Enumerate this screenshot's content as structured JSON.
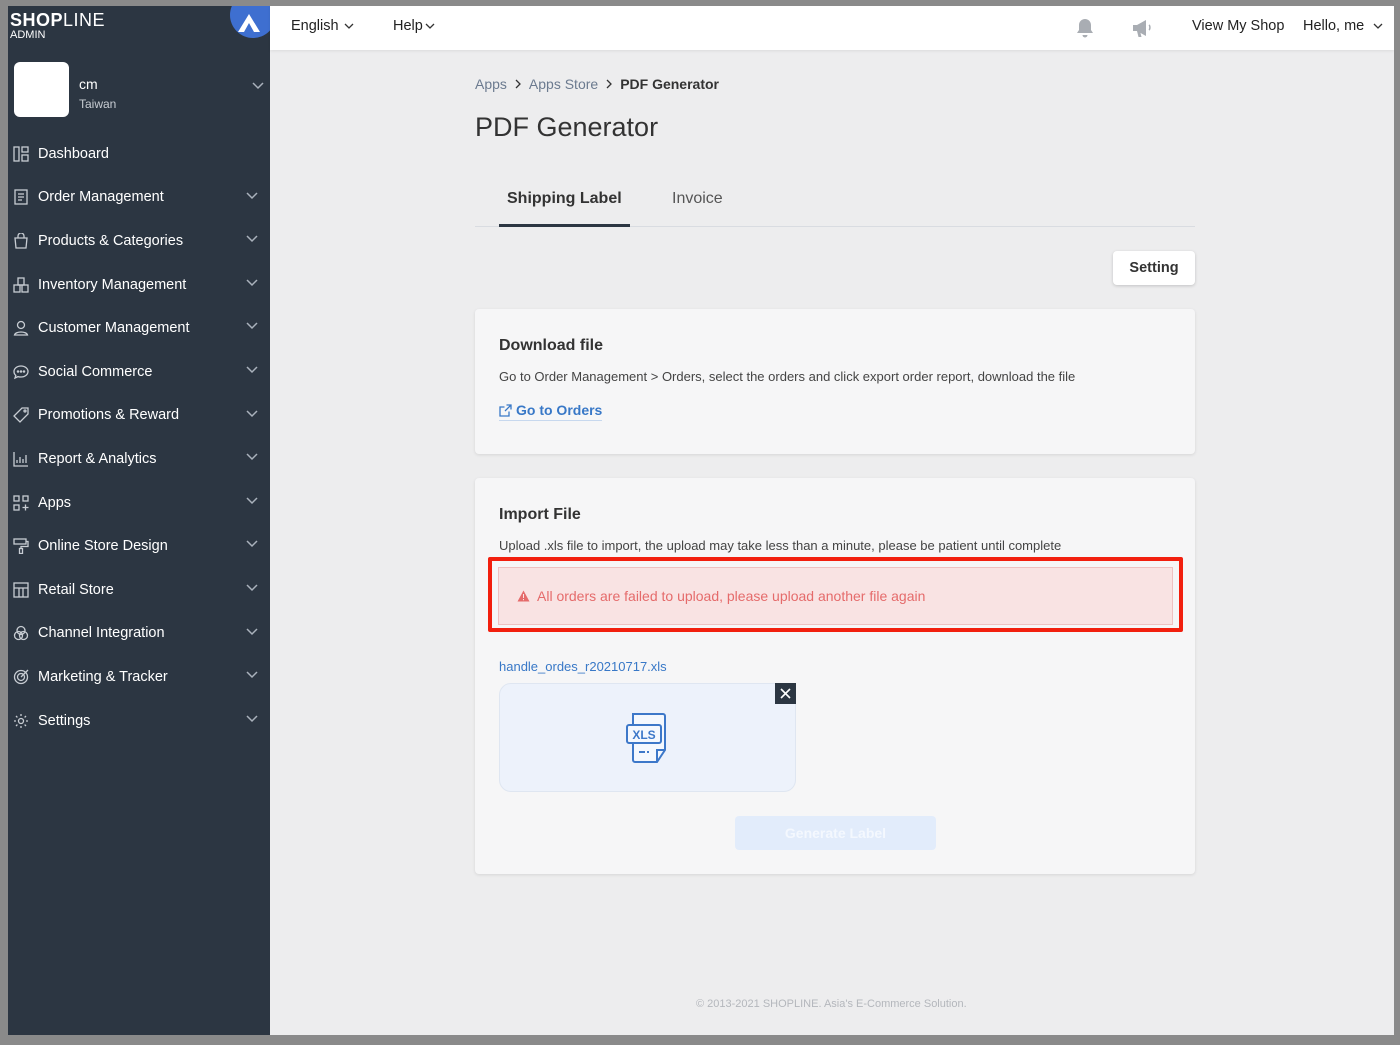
{
  "brand": {
    "name_bold": "SHOP",
    "name_thin": "LINE",
    "sub": "ADMIN"
  },
  "shop": {
    "name": "cm",
    "region": "Taiwan"
  },
  "sidebar": {
    "items": [
      {
        "label": "Dashboard",
        "icon": "dashboard-icon"
      },
      {
        "label": "Order Management",
        "icon": "order-icon"
      },
      {
        "label": "Products & Categories",
        "icon": "bag-icon"
      },
      {
        "label": "Inventory Management",
        "icon": "inventory-icon"
      },
      {
        "label": "Customer Management",
        "icon": "person-icon"
      },
      {
        "label": "Social Commerce",
        "icon": "chat-icon"
      },
      {
        "label": "Promotions & Reward",
        "icon": "tag-icon"
      },
      {
        "label": "Report & Analytics",
        "icon": "chart-icon"
      },
      {
        "label": "Apps",
        "icon": "apps-icon"
      },
      {
        "label": "Online Store Design",
        "icon": "brush-icon"
      },
      {
        "label": "Retail Store",
        "icon": "store-icon"
      },
      {
        "label": "Channel Integration",
        "icon": "channel-icon"
      },
      {
        "label": "Marketing & Tracker",
        "icon": "target-icon"
      },
      {
        "label": "Settings",
        "icon": "gear-icon"
      }
    ]
  },
  "topbar": {
    "language": "English",
    "help": "Help",
    "view_shop": "View My Shop",
    "greeting": "Hello, me"
  },
  "breadcrumb": {
    "apps": "Apps",
    "store": "Apps Store",
    "current": "PDF Generator"
  },
  "page_title": "PDF Generator",
  "tabs": {
    "shipping": "Shipping Label",
    "invoice": "Invoice"
  },
  "setting_button": "Setting",
  "download": {
    "title": "Download file",
    "desc": "Go to Order Management > Orders, select the orders and click export order report, download the file",
    "link": "Go to Orders"
  },
  "import": {
    "title": "Import File",
    "desc": "Upload .xls file to import, the upload may take less than a minute, please be patient until complete",
    "error": "All orders are failed to upload, please upload another file again",
    "file_name": "handle_ordes_r20210717.xls",
    "file_type": "XLS",
    "generate": "Generate Label"
  },
  "footer": "© 2013-2021 SHOPLINE. Asia's E-Commerce Solution.",
  "colors": {
    "sidebar": "#2c3642",
    "link": "#3878c7",
    "error": "#e56b6b",
    "highlight": "#f21f0e"
  }
}
